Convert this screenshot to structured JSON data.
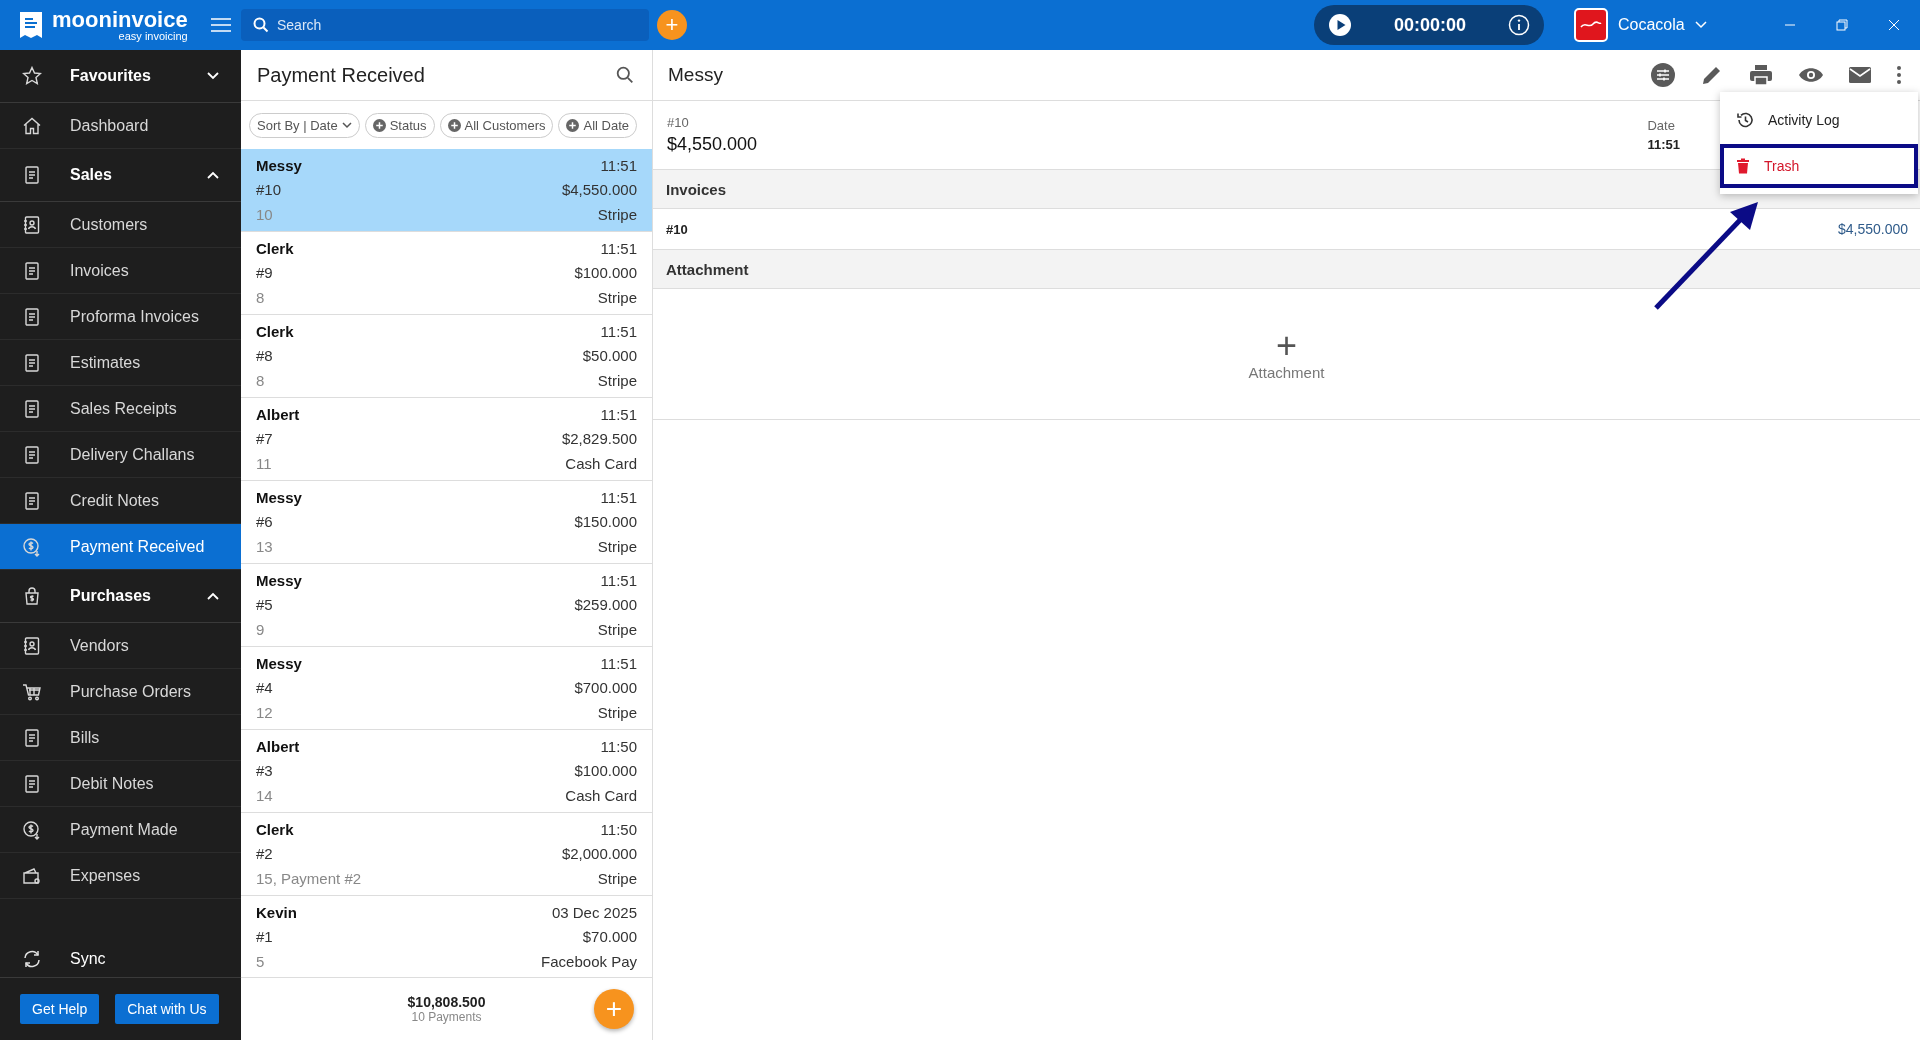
{
  "topbar": {
    "brand": "mooninvoice",
    "tagline": "easy invoicing",
    "search": {
      "placeholder": "Search"
    },
    "add_label": "+",
    "timer": "00:00:00",
    "company": "Cocacola"
  },
  "sidebar": {
    "items": [
      {
        "label": "Favourites",
        "kind": "group",
        "expanded": false,
        "selected": false
      },
      {
        "label": "Dashboard",
        "kind": "link",
        "selected": false
      },
      {
        "label": "Sales",
        "kind": "group",
        "expanded": true,
        "selected": false,
        "children": [
          {
            "label": "Customers",
            "selected": false
          },
          {
            "label": "Invoices",
            "selected": false
          },
          {
            "label": "Proforma Invoices",
            "selected": false
          },
          {
            "label": "Estimates",
            "selected": false
          },
          {
            "label": "Sales Receipts",
            "selected": false
          },
          {
            "label": "Delivery Challans",
            "selected": false
          },
          {
            "label": "Credit Notes",
            "selected": false
          },
          {
            "label": "Payment Received",
            "selected": true
          }
        ]
      },
      {
        "label": "Purchases",
        "kind": "group",
        "expanded": true,
        "selected": false,
        "children": [
          {
            "label": "Vendors",
            "selected": false
          },
          {
            "label": "Purchase Orders",
            "selected": false
          },
          {
            "label": "Bills",
            "selected": false
          },
          {
            "label": "Debit Notes",
            "selected": false
          },
          {
            "label": "Payment Made",
            "selected": false
          },
          {
            "label": "Expenses",
            "selected": false
          }
        ]
      }
    ],
    "sync": "Sync",
    "buttons": [
      "Get Help",
      "Chat with Us"
    ]
  },
  "list": {
    "title": "Payment Received",
    "filters": [
      {
        "label": "Sort By | Date",
        "kind": "sort"
      },
      {
        "label": "Status",
        "kind": "add"
      },
      {
        "label": "All Customers",
        "kind": "add"
      },
      {
        "label": "All Date",
        "kind": "add"
      }
    ],
    "rows": [
      {
        "name": "Messy",
        "time": "11:51",
        "number": "#10",
        "amount": "$4,550.000",
        "ref": "10",
        "method": "Stripe",
        "selected": true
      },
      {
        "name": "Clerk",
        "time": "11:51",
        "number": "#9",
        "amount": "$100.000",
        "ref": "8",
        "method": "Stripe",
        "selected": false
      },
      {
        "name": "Clerk",
        "time": "11:51",
        "number": "#8",
        "amount": "$50.000",
        "ref": "8",
        "method": "Stripe",
        "selected": false
      },
      {
        "name": "Albert",
        "time": "11:51",
        "number": "#7",
        "amount": "$2,829.500",
        "ref": "11",
        "method": "Cash Card",
        "selected": false
      },
      {
        "name": "Messy",
        "time": "11:51",
        "number": "#6",
        "amount": "$150.000",
        "ref": "13",
        "method": "Stripe",
        "selected": false
      },
      {
        "name": "Messy",
        "time": "11:51",
        "number": "#5",
        "amount": "$259.000",
        "ref": "9",
        "method": "Stripe",
        "selected": false
      },
      {
        "name": "Messy",
        "time": "11:51",
        "number": "#4",
        "amount": "$700.000",
        "ref": "12",
        "method": "Stripe",
        "selected": false
      },
      {
        "name": "Albert",
        "time": "11:50",
        "number": "#3",
        "amount": "$100.000",
        "ref": "14",
        "method": "Cash Card",
        "selected": false
      },
      {
        "name": "Clerk",
        "time": "11:50",
        "number": "#2",
        "amount": "$2,000.000",
        "ref": "15, Payment #2",
        "method": "Stripe",
        "selected": false
      },
      {
        "name": "Kevin",
        "time": "03 Dec 2025",
        "number": "#1",
        "amount": "$70.000",
        "ref": "5",
        "method": "Facebook Pay",
        "selected": false
      }
    ],
    "fab_label": "+",
    "total": "$10,808.500",
    "count": "10 Payments"
  },
  "detail": {
    "title": "Messy",
    "number": "#10",
    "amount": "$4,550.000",
    "date_label": "Date",
    "date": "11:51",
    "sections": [
      {
        "title": "Invoices",
        "kind": "invoices",
        "rows": [
          {
            "number": "#10",
            "amount": "$4,550.000"
          }
        ]
      },
      {
        "title": "Attachment",
        "kind": "attachment",
        "add_label": "+",
        "add_text": "Attachment"
      }
    ],
    "menu": [
      {
        "label": "Activity Log",
        "kind": "history",
        "highlighted": false
      },
      {
        "label": "Trash",
        "kind": "delete",
        "highlighted": true
      }
    ]
  }
}
